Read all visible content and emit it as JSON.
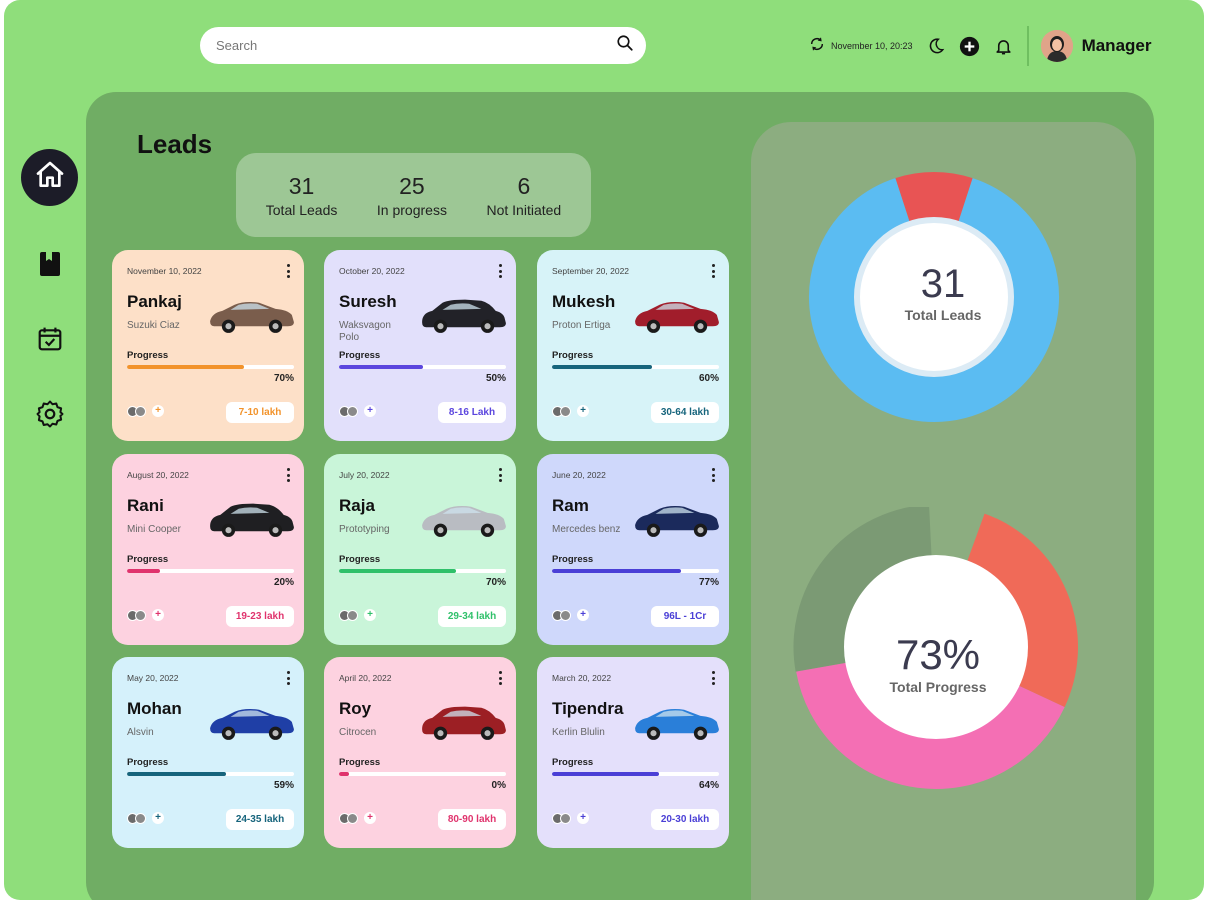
{
  "header": {
    "search_placeholder": "Search",
    "datetime": "November 10, 20:23",
    "user_name": "Manager"
  },
  "sidebar": {
    "items": [
      {
        "name": "home",
        "icon": "home-icon",
        "active": true
      },
      {
        "name": "bookmarks",
        "icon": "book-icon",
        "active": false
      },
      {
        "name": "calendar",
        "icon": "calendar-check-icon",
        "active": false
      },
      {
        "name": "settings",
        "icon": "gear-icon",
        "active": false
      }
    ]
  },
  "page": {
    "title": "Leads"
  },
  "stats": [
    {
      "value": "31",
      "label": "Total Leads"
    },
    {
      "value": "25",
      "label": "In progress"
    },
    {
      "value": "6",
      "label": "Not Initiated"
    }
  ],
  "progress_label": "Progress",
  "leads": [
    {
      "date": "November 10, 2022",
      "name": "Pankaj",
      "model": "Suzuki Ciaz",
      "progress": 70,
      "progress_text": "70%",
      "price": "7-10 lakh",
      "bg": "#fde0c8",
      "bar": "#f2932b",
      "price_color": "#f2932b",
      "car": "#7a5d4c"
    },
    {
      "date": "October 20, 2022",
      "name": "Suresh",
      "model": "Waksvagon Polo",
      "progress": 50,
      "progress_text": "50%",
      "price": "8-16 Lakh",
      "bg": "#e2e0fb",
      "bar": "#5b46de",
      "price_color": "#5b46de",
      "car": "#222228"
    },
    {
      "date": "September 20, 2022",
      "name": "Mukesh",
      "model": "Proton Ertiga",
      "progress": 60,
      "progress_text": "60%",
      "price": "30-64 lakh",
      "bg": "#d7f3f8",
      "bar": "#16647c",
      "price_color": "#16647c",
      "car": "#a11d2b"
    },
    {
      "date": "August 20, 2022",
      "name": "Rani",
      "model": "Mini Cooper",
      "progress": 20,
      "progress_text": "20%",
      "price": "19-23 lakh",
      "bg": "#fdd2e0",
      "bar": "#e0336d",
      "price_color": "#e0336d",
      "car": "#1f1f22"
    },
    {
      "date": "July 20, 2022",
      "name": "Raja",
      "model": "Prototyping",
      "progress": 70,
      "progress_text": "70%",
      "price": "29-34 lakh",
      "bg": "#c9f5d9",
      "bar": "#2fc06a",
      "price_color": "#2fc06a",
      "car": "#b9bcc2"
    },
    {
      "date": "June 20, 2022",
      "name": "Ram",
      "model": "Mercedes benz",
      "progress": 77,
      "progress_text": "77%",
      "price": "96L - 1Cr",
      "bg": "#cfd8fb",
      "bar": "#4a3fd6",
      "price_color": "#4a3fd6",
      "car": "#1b2a5c"
    },
    {
      "date": "May 20, 2022",
      "name": "Mohan",
      "model": "Alsvin",
      "progress": 59,
      "progress_text": "59%",
      "price": "24-35 lakh",
      "bg": "#d5f1fb",
      "bar": "#16647c",
      "price_color": "#16647c",
      "car": "#1f3fa6"
    },
    {
      "date": "April 20, 2022",
      "name": "Roy",
      "model": "Citrocen",
      "progress": 0,
      "progress_text": "0%",
      "price": "80-90 lakh",
      "bg": "#fdd2e0",
      "bar": "#e0336d",
      "price_color": "#e0336d",
      "car": "#9c1f24"
    },
    {
      "date": "March 20, 2022",
      "name": "Tipendra",
      "model": "Kerlin Blulin",
      "progress": 64,
      "progress_text": "64%",
      "price": "20-30 lakh",
      "bg": "#e4e0fb",
      "bar": "#4a3fd6",
      "price_color": "#4a3fd6",
      "car": "#2a7fd9"
    }
  ],
  "donut_leads": {
    "value": "31",
    "label": "Total Leads",
    "segments": [
      {
        "fraction": 0.1,
        "color": "#e85454"
      },
      {
        "fraction": 0.9,
        "color": "#5bbcf2"
      }
    ]
  },
  "donut_progress": {
    "value": "73%",
    "label": "Total Progress",
    "progress": 73,
    "colors": {
      "grey": "#7b9a74",
      "pink": "#f46fb4",
      "orange": "#f06a58"
    }
  }
}
